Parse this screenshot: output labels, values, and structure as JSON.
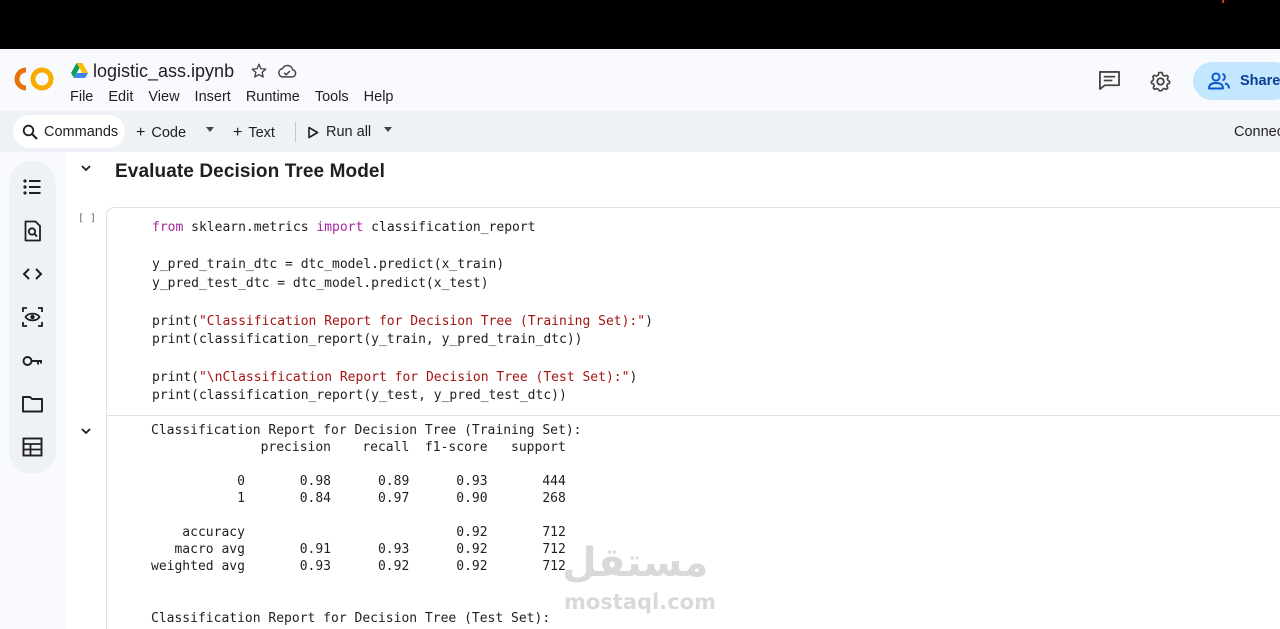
{
  "app": {
    "filename": "logistic_ass.ipynb",
    "menu": [
      "File",
      "Edit",
      "View",
      "Insert",
      "Runtime",
      "Tools",
      "Help"
    ],
    "share_label": "Share"
  },
  "toolbar": {
    "commands_label": "Commands",
    "code_label": "Code",
    "text_label": "Text",
    "run_all_label": "Run all",
    "connect_label": "Connect"
  },
  "notebook": {
    "section_title": "Evaluate Decision Tree Model",
    "run_bracket": "[ ]",
    "code_lines": [
      {
        "kw1": "from",
        "t1": " sklearn.metrics ",
        "kw2": "import",
        "t2": " classification_report"
      },
      {
        "text": "y_pred_train_dtc = dtc_model.predict(x_train)"
      },
      {
        "text": "y_pred_test_dtc = dtc_model.predict(x_test)"
      },
      {
        "fn": "print(",
        "str": "\"Classification Report for Decision Tree (Training Set):\"",
        "end": ")"
      },
      {
        "text": "print(classification_report(y_train, y_pred_train_dtc))"
      },
      {
        "fn": "print(",
        "str": "\"\\nClassification Report for Decision Tree (Test Set):\"",
        "end": ")"
      },
      {
        "text": "print(classification_report(y_test, y_pred_test_dtc))"
      }
    ],
    "output_lines": [
      "Classification Report for Decision Tree (Training Set):",
      "              precision    recall  f1-score   support",
      "",
      "           0       0.98      0.89      0.93       444",
      "           1       0.84      0.97      0.90       268",
      "",
      "    accuracy                           0.92       712",
      "   macro avg       0.91      0.93      0.92       712",
      "weighted avg       0.93      0.92      0.92       712",
      "",
      "",
      "Classification Report for Decision Tree (Test Set):"
    ]
  },
  "watermark": {
    "arabic": "مستقل",
    "latin": "mostaql.com"
  },
  "colors": {
    "keyword": "#a626a4",
    "string": "#a31515",
    "share_bg": "#c2e7ff",
    "logo_orange": "#f9ab00",
    "logo_dark_orange": "#e8710a"
  }
}
